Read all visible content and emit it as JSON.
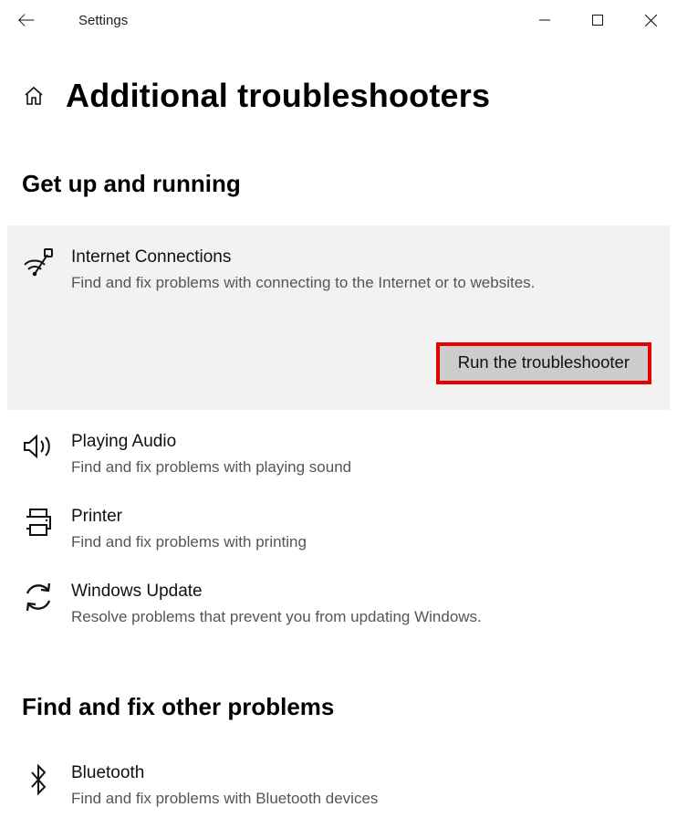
{
  "titlebar": {
    "title": "Settings"
  },
  "page": {
    "title": "Additional troubleshooters"
  },
  "sections": {
    "getUpRunning": {
      "heading": "Get up and running",
      "items": [
        {
          "title": "Internet Connections",
          "desc": "Find and fix problems with connecting to the Internet or to websites.",
          "action": "Run the troubleshooter"
        },
        {
          "title": "Playing Audio",
          "desc": "Find and fix problems with playing sound"
        },
        {
          "title": "Printer",
          "desc": "Find and fix problems with printing"
        },
        {
          "title": "Windows Update",
          "desc": "Resolve problems that prevent you from updating Windows."
        }
      ]
    },
    "findFixOther": {
      "heading": "Find and fix other problems",
      "items": [
        {
          "title": "Bluetooth",
          "desc": "Find and fix problems with Bluetooth devices"
        }
      ]
    }
  }
}
